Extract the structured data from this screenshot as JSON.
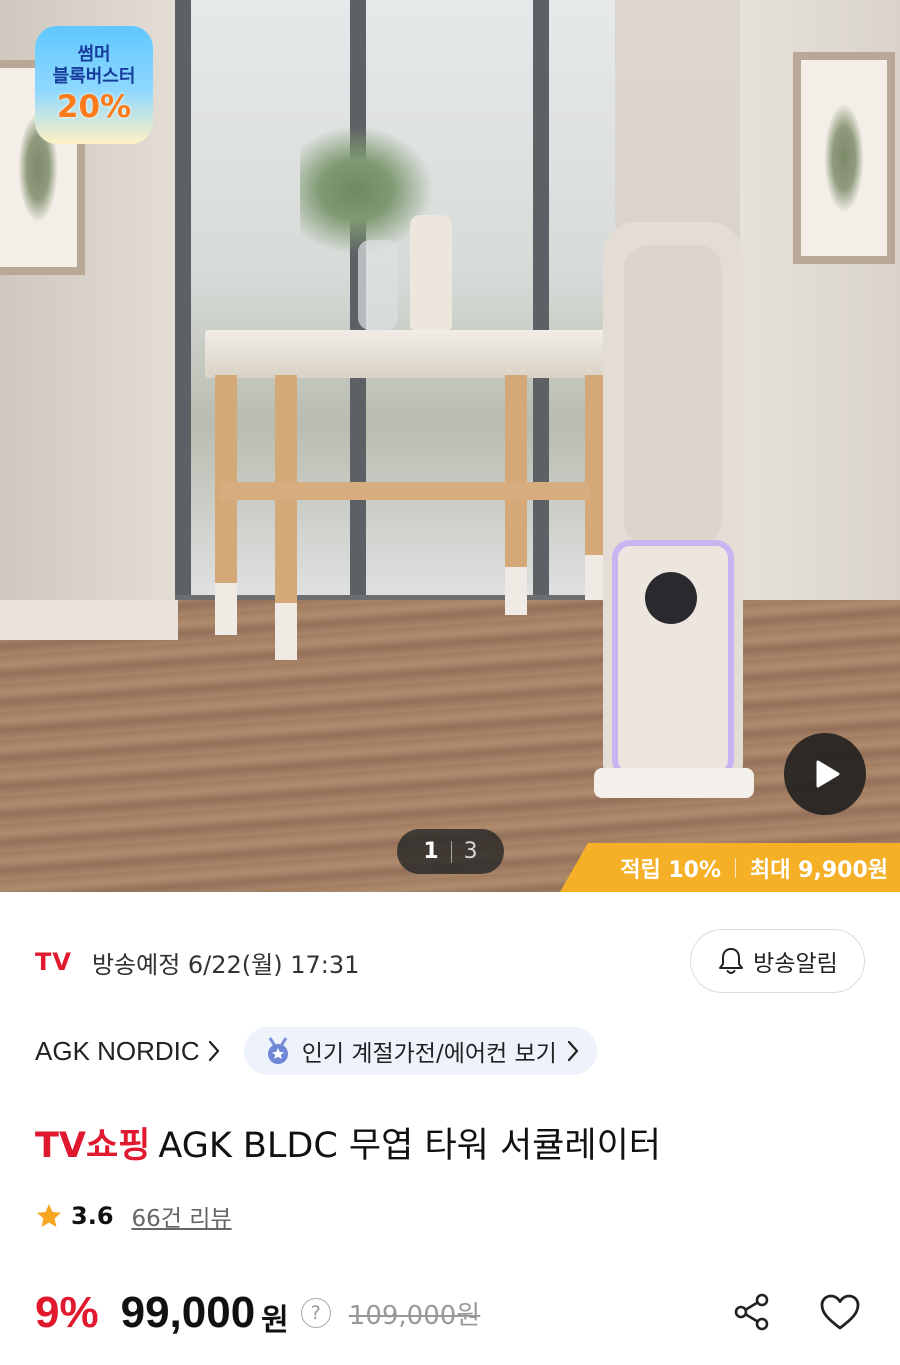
{
  "hero": {
    "badge": {
      "line1": "썸머",
      "line2": "블록버스터",
      "percent": "20%"
    },
    "pager": {
      "current": "1",
      "total": "3"
    },
    "points": {
      "rate": "적립 10%",
      "max": "최대 9,900원"
    },
    "icons": {
      "play": "play-icon"
    }
  },
  "broadcast": {
    "logo": "TV",
    "schedule": "방송예정 6/22(월) 17:31",
    "alarm_label": "방송알림"
  },
  "brand": {
    "name": "AGK NORDIC",
    "category_chip": "인기 계절가전/에어컨 보기"
  },
  "product": {
    "title_prefix": "TV쇼핑",
    "title": "AGK BLDC 무엽 타워 서큘레이터",
    "rating": "3.6",
    "reviews": "66건 리뷰"
  },
  "price": {
    "discount": "9%",
    "sale": "99,000",
    "currency": "원",
    "help": "?",
    "original": "109,000원"
  },
  "colors": {
    "accent_red": "#e0192e",
    "points_orange": "#f6b027",
    "star": "#f6a623"
  }
}
